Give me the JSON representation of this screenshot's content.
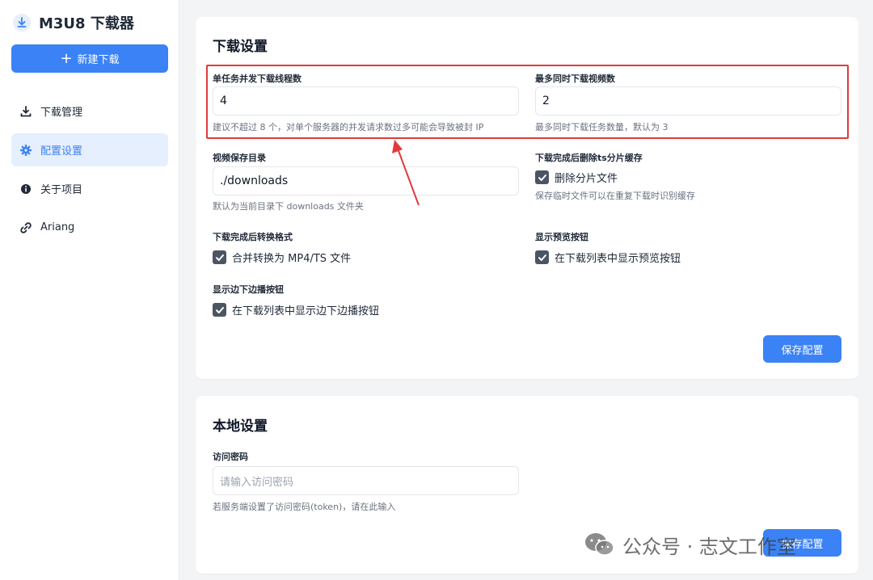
{
  "app": {
    "title": "M3U8 下载器",
    "new_download_label": "新建下载"
  },
  "nav": [
    {
      "label": "下载管理",
      "icon": "download-icon",
      "active": false
    },
    {
      "label": "配置设置",
      "icon": "gear-icon",
      "active": true
    },
    {
      "label": "关于项目",
      "icon": "info-icon",
      "active": false
    },
    {
      "label": "Ariang",
      "icon": "link-icon",
      "active": false
    }
  ],
  "download_settings": {
    "title": "下载设置",
    "threads": {
      "label": "单任务并发下载线程数",
      "value": "4",
      "hint": "建议不超过 8 个，对单个服务器的并发请求数过多可能会导致被封 IP"
    },
    "max_concurrent": {
      "label": "最多同时下载视频数",
      "value": "2",
      "hint": "最多同时下载任务数量，默认为 3"
    },
    "save_dir": {
      "label": "视频保存目录",
      "value": "./downloads",
      "hint": "默认为当前目录下 downloads 文件夹"
    },
    "delete_ts": {
      "label": "下载完成后删除ts分片缓存",
      "checkbox_label": "删除分片文件",
      "checked": true,
      "hint": "保存临时文件可以在重复下载时识别缓存"
    },
    "convert": {
      "label": "下载完成后转换格式",
      "checkbox_label": "合并转换为 MP4/TS 文件",
      "checked": true
    },
    "preview": {
      "label": "显示预览按钮",
      "checkbox_label": "在下载列表中显示预览按钮",
      "checked": true
    },
    "play_while_download": {
      "label": "显示边下边播按钮",
      "checkbox_label": "在下载列表中显示边下边播按钮",
      "checked": true
    },
    "save_label": "保存配置"
  },
  "local_settings": {
    "title": "本地设置",
    "password": {
      "label": "访问密码",
      "placeholder": "请输入访问密码",
      "hint": "若服务端设置了访问密码(token)，请在此输入"
    },
    "save_label": "保存配置"
  },
  "watermark": {
    "text": "公众号 · 志文工作室"
  },
  "colors": {
    "accent": "#3b82f6",
    "annotation": "#e03a3a",
    "active_nav_bg": "#e6effd"
  }
}
